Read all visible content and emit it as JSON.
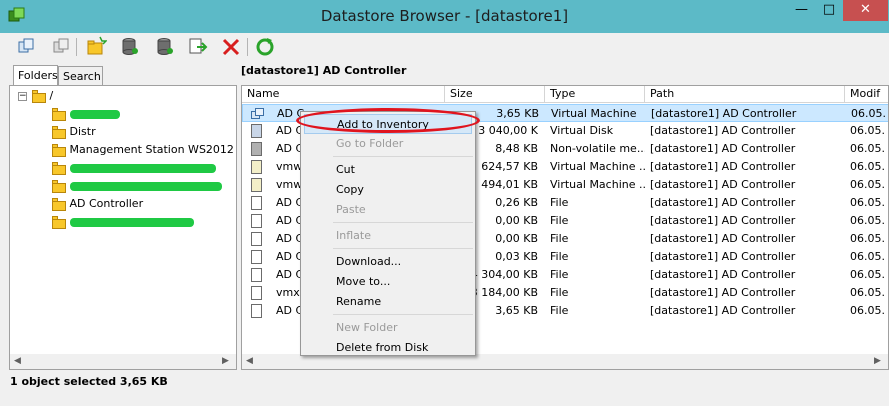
{
  "window": {
    "title": "Datastore Browser - [datastore1]",
    "min": "—",
    "max": "□",
    "close": "✕"
  },
  "toolbar": {
    "icons": [
      "upload-icon",
      "download-icon",
      "new-folder-icon",
      "datastore-icon",
      "datastore-alt-icon",
      "move-icon",
      "delete-icon",
      "refresh-icon"
    ]
  },
  "tabs": [
    {
      "label": "Folders"
    },
    {
      "label": "Search"
    }
  ],
  "tree": {
    "root": "/",
    "items": [
      {
        "label": "",
        "redacted": true
      },
      {
        "label": "Distr"
      },
      {
        "label": "Management Station WS2012"
      },
      {
        "label": "",
        "redacted": true
      },
      {
        "label": "",
        "redacted": true
      },
      {
        "label": "AD Controller"
      },
      {
        "label": "",
        "redacted": true
      }
    ]
  },
  "list": {
    "path_label": "[datastore1] AD Controller",
    "columns": [
      "Name",
      "Size",
      "Type",
      "Path",
      "Modif"
    ],
    "rows": [
      {
        "name": "AD Co",
        "size": "3,65 KB",
        "type": "Virtual Machine",
        "path": "[datastore1] AD Controller",
        "mod": "06.05.",
        "icon": "vm",
        "selected": true
      },
      {
        "name": "AD C",
        "size": "3 040,00 K",
        "type": "Virtual Disk",
        "path": "[datastore1] AD Controller",
        "mod": "06.05.",
        "icon": "disk"
      },
      {
        "name": "AD C",
        "size": "8,48 KB",
        "type": "Non-volatile me...",
        "path": "[datastore1] AD Controller",
        "mod": "06.05.",
        "icon": "nvram"
      },
      {
        "name": "vmw",
        "size": "624,57 KB",
        "type": "Virtual Machine ...",
        "path": "[datastore1] AD Controller",
        "mod": "06.05.",
        "icon": "log"
      },
      {
        "name": "vmw",
        "size": "494,01 KB",
        "type": "Virtual Machine ...",
        "path": "[datastore1] AD Controller",
        "mod": "06.05.",
        "icon": "log"
      },
      {
        "name": "AD C",
        "size": "0,26 KB",
        "type": "File",
        "path": "[datastore1] AD Controller",
        "mod": "06.05.",
        "icon": "file"
      },
      {
        "name": "AD C",
        "size": "0,00 KB",
        "type": "File",
        "path": "[datastore1] AD Controller",
        "mod": "06.05.",
        "icon": "file"
      },
      {
        "name": "AD C",
        "size": "0,00 KB",
        "type": "File",
        "path": "[datastore1] AD Controller",
        "mod": "06.05.",
        "icon": "file"
      },
      {
        "name": "AD C",
        "size": "0,03 KB",
        "type": "File",
        "path": "[datastore1] AD Controller",
        "mod": "06.05.",
        "icon": "file"
      },
      {
        "name": "AD C",
        "size": "94 304,00 KB",
        "type": "File",
        "path": "[datastore1] AD Controller",
        "mod": "06.05.",
        "icon": "file"
      },
      {
        "name": "vmx-",
        "size": "93 184,00 KB",
        "type": "File",
        "path": "[datastore1] AD Controller",
        "mod": "06.05.",
        "icon": "file"
      },
      {
        "name": "AD C",
        "size": "3,65 KB",
        "type": "File",
        "path": "[datastore1] AD Controller",
        "mod": "06.05.",
        "icon": "file"
      }
    ]
  },
  "context_menu": {
    "items": [
      {
        "label": "Add to Inventory",
        "disabled": false,
        "highlight": true
      },
      {
        "label": "Go to Folder",
        "disabled": true
      },
      {
        "sep": true
      },
      {
        "label": "Cut",
        "disabled": false
      },
      {
        "label": "Copy",
        "disabled": false
      },
      {
        "label": "Paste",
        "disabled": true
      },
      {
        "sep": true
      },
      {
        "label": "Inflate",
        "disabled": true
      },
      {
        "sep": true
      },
      {
        "label": "Download...",
        "disabled": false
      },
      {
        "label": "Move to...",
        "disabled": false
      },
      {
        "label": "Rename",
        "disabled": false
      },
      {
        "sep": true
      },
      {
        "label": "New Folder",
        "disabled": true
      },
      {
        "label": "Delete from Disk",
        "disabled": false
      }
    ]
  },
  "status": {
    "text": "1 object selected 3,65 KB"
  },
  "colors": {
    "titlebar": "#5cbac7",
    "selection": "#cce8ff",
    "annotation": "#e0141e",
    "redaction": "#1fc944"
  }
}
